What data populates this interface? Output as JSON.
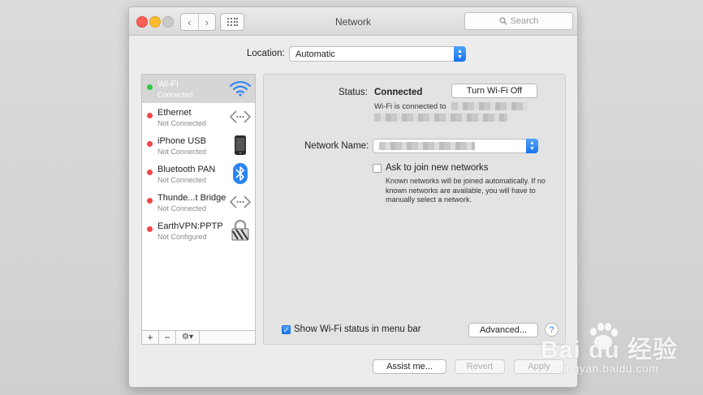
{
  "window": {
    "title": "Network",
    "search_placeholder": "Search",
    "nav_back": "‹",
    "nav_forward": "›"
  },
  "location": {
    "label": "Location:",
    "value": "Automatic"
  },
  "services": [
    {
      "name": "Wi-Fi",
      "status": "Connected",
      "dot_color": "#2fcb4b",
      "icon": "wifi-icon",
      "selected": true
    },
    {
      "name": "Ethernet",
      "status": "Not Connected",
      "dot_color": "#f2474a",
      "icon": "ethernet-icon",
      "selected": false
    },
    {
      "name": "iPhone USB",
      "status": "Not Connected",
      "dot_color": "#f2474a",
      "icon": "iphone-icon",
      "selected": false
    },
    {
      "name": "Bluetooth PAN",
      "status": "Not Connected",
      "dot_color": "#f2474a",
      "icon": "bluetooth-icon",
      "selected": false
    },
    {
      "name": "Thunde...t Bridge",
      "status": "Not Connected",
      "dot_color": "#f2474a",
      "icon": "thunderbolt-bridge-icon",
      "selected": false
    },
    {
      "name": "EarthVPN:PPTP",
      "status": "Not Configured",
      "dot_color": "#f2474a",
      "icon": "vpn-lock-icon",
      "selected": false
    }
  ],
  "sidebar_footer": {
    "add": "+",
    "remove": "−",
    "gear": "⚙▾"
  },
  "detail": {
    "status_label": "Status:",
    "status_value": "Connected",
    "turn_off_button": "Turn Wi-Fi Off",
    "connected_info": "Wi-Fi is connected to",
    "network_name_label": "Network Name:",
    "ask_join_label": "Ask to join new networks",
    "ask_join_checked": false,
    "ask_join_help": "Known networks will be joined automatically. If no known networks are available, you will have to manually select a network.",
    "show_status_label": "Show Wi-Fi status in menu bar",
    "show_status_checked": true,
    "advanced_button": "Advanced...",
    "help_button": "?"
  },
  "footer_buttons": {
    "assist": "Assist me...",
    "revert": "Revert",
    "apply": "Apply"
  },
  "watermark": {
    "logo": "Bai du 经验",
    "url": "jingyan.baidu.com"
  },
  "colors": {
    "accent_blue": "#1b74ec",
    "green_dot": "#2fcb4b",
    "red_dot": "#f2474a"
  }
}
